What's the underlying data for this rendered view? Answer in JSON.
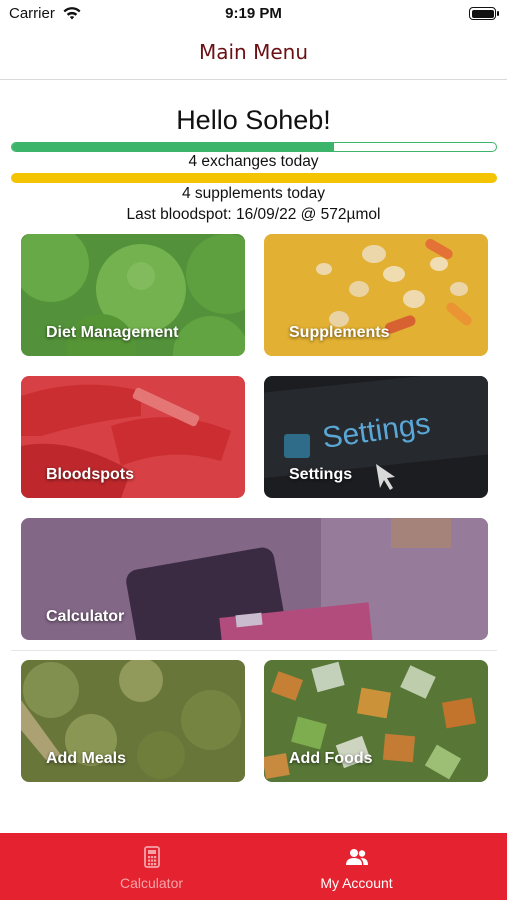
{
  "status_bar": {
    "carrier": "Carrier",
    "time": "9:19 PM"
  },
  "nav": {
    "title": "Main Menu"
  },
  "greeting": "Hello Soheb!",
  "exchanges": {
    "text": "4 exchanges today",
    "progress": 0.666
  },
  "supplements": {
    "text": "4 supplements today",
    "progress": 1.0
  },
  "bloodspot": {
    "text": "Last bloodspot: 16/09/22 @ 572µmol"
  },
  "tiles": [
    {
      "label": "Diet Management"
    },
    {
      "label": "Supplements"
    },
    {
      "label": "Bloodspots"
    },
    {
      "label": "Settings",
      "image_text": "Settings"
    },
    {
      "label": "Calculator"
    },
    {
      "label": "Add Meals"
    },
    {
      "label": "Add Foods"
    }
  ],
  "tab_bar": {
    "tabs": [
      {
        "label": "Calculator",
        "icon": "calculator-icon",
        "selected": false
      },
      {
        "label": "My Account",
        "icon": "users-icon",
        "selected": true
      }
    ]
  },
  "colors": {
    "nav_title": "#6b1014",
    "exchanges_bar": "#3cb46a",
    "supplements_bar": "#f5c400",
    "tab_bar": "#e52330"
  }
}
